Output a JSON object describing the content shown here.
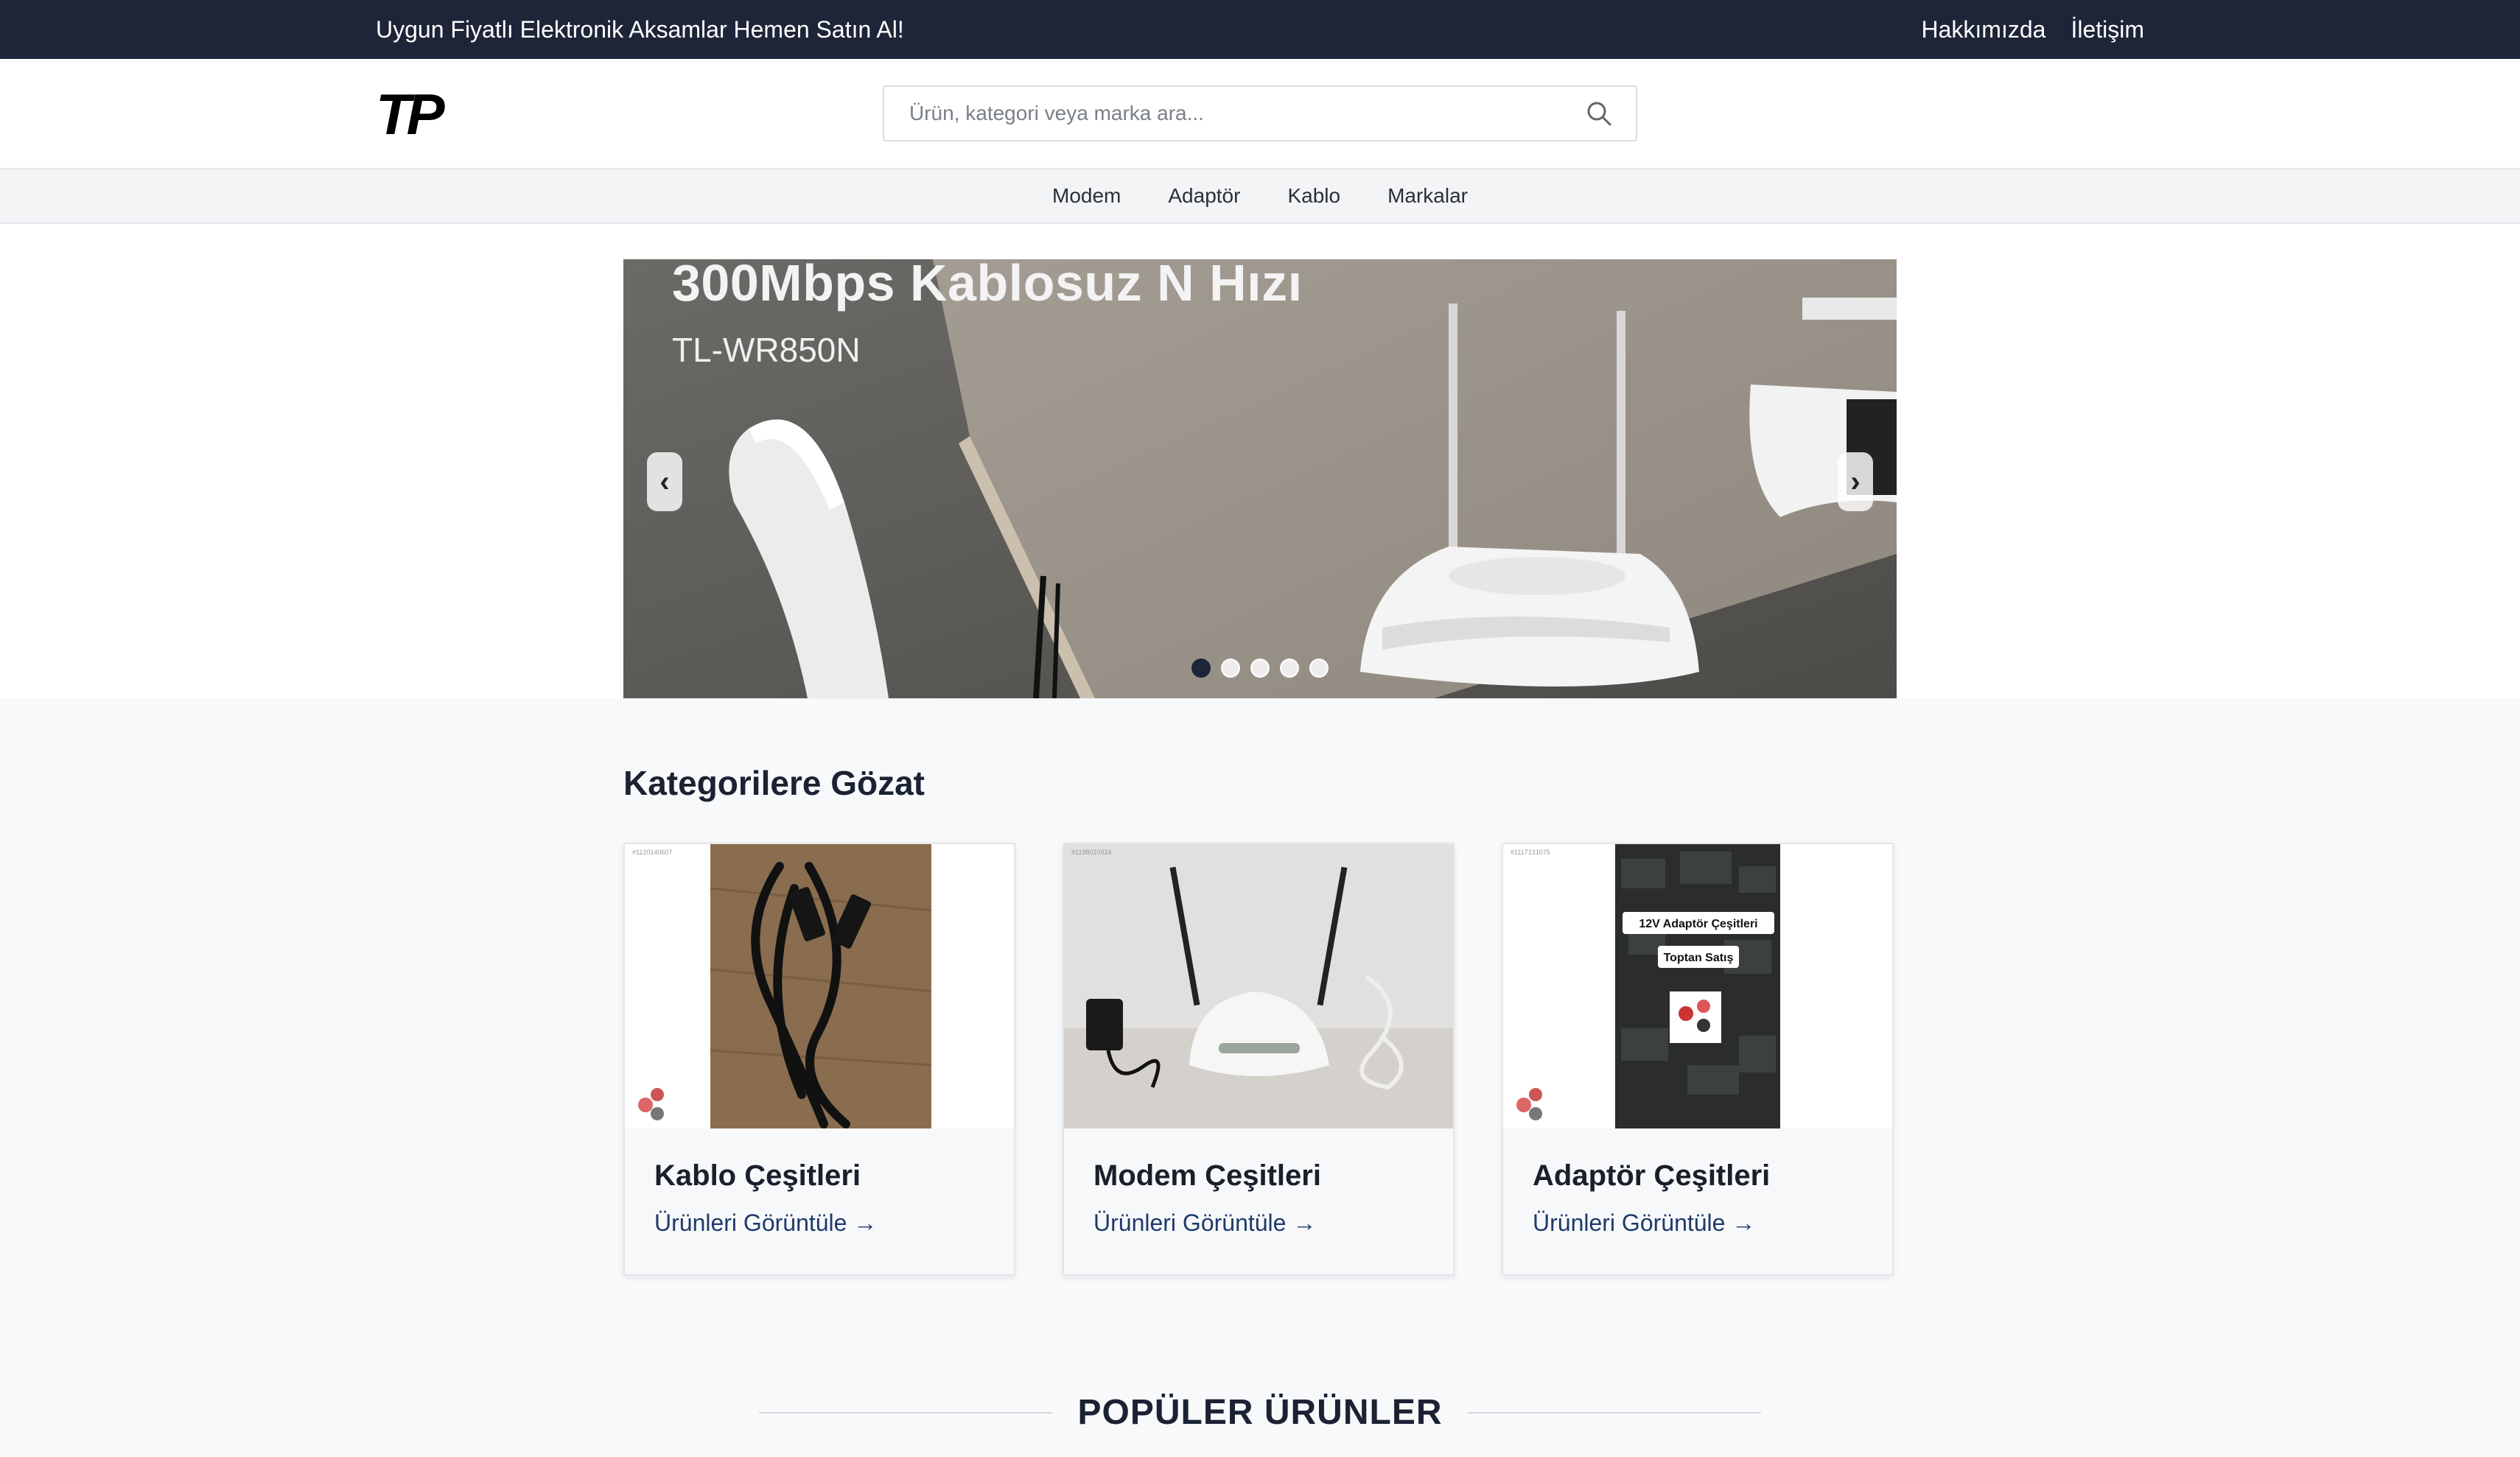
{
  "topbar": {
    "promo": "Uygun Fiyatlı Elektronik Aksamlar Hemen Satın Al!",
    "links": [
      "Hakkımızda",
      "İletişim"
    ]
  },
  "header": {
    "logo_text": "TP",
    "search_placeholder": "Ürün, kategori veya marka ara..."
  },
  "nav": [
    "Modem",
    "Adaptör",
    "Kablo",
    "Markalar"
  ],
  "slider": {
    "title": "300Mbps Kablosuz N Hızı",
    "subtitle": "TL-WR850N",
    "prev": "‹",
    "next": "›",
    "slide_count": 5,
    "active_index": 0
  },
  "categories": {
    "title": "Kategorilere Gözat",
    "items": [
      {
        "name": "Kablo Çeşitleri",
        "link": "Ürünleri Görüntüle →",
        "image_tag": "#1120140607"
      },
      {
        "name": "Modem Çeşitleri",
        "link": "Ürünleri Görüntüle →",
        "image_tag": "#1198010924"
      },
      {
        "name": "Adaptör Çeşitleri",
        "link": "Ürünleri Görüntüle →",
        "image_tag": "#1117131075",
        "image_labels": [
          "12V Adaptör Çeşitleri",
          "Toptan Satış"
        ]
      }
    ]
  },
  "popular": {
    "title": "POPÜLER ÜRÜNLER"
  },
  "colors": {
    "primary": "#1e2538",
    "link": "#1e3a6b",
    "background": "#f8f9fb"
  }
}
